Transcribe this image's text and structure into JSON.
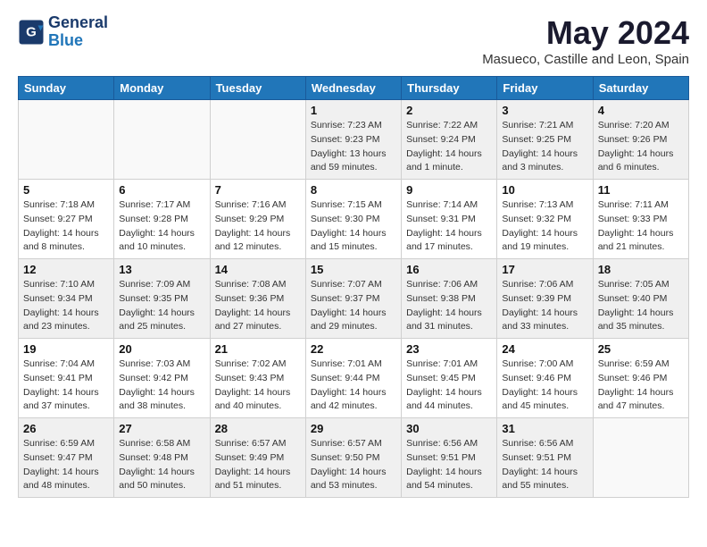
{
  "logo": {
    "line1": "General",
    "line2": "Blue"
  },
  "title": "May 2024",
  "location": "Masueco, Castille and Leon, Spain",
  "weekdays": [
    "Sunday",
    "Monday",
    "Tuesday",
    "Wednesday",
    "Thursday",
    "Friday",
    "Saturday"
  ],
  "weeks": [
    [
      {
        "day": "",
        "sunrise": "",
        "sunset": "",
        "daylight": ""
      },
      {
        "day": "",
        "sunrise": "",
        "sunset": "",
        "daylight": ""
      },
      {
        "day": "",
        "sunrise": "",
        "sunset": "",
        "daylight": ""
      },
      {
        "day": "1",
        "sunrise": "Sunrise: 7:23 AM",
        "sunset": "Sunset: 9:23 PM",
        "daylight": "Daylight: 13 hours and 59 minutes."
      },
      {
        "day": "2",
        "sunrise": "Sunrise: 7:22 AM",
        "sunset": "Sunset: 9:24 PM",
        "daylight": "Daylight: 14 hours and 1 minute."
      },
      {
        "day": "3",
        "sunrise": "Sunrise: 7:21 AM",
        "sunset": "Sunset: 9:25 PM",
        "daylight": "Daylight: 14 hours and 3 minutes."
      },
      {
        "day": "4",
        "sunrise": "Sunrise: 7:20 AM",
        "sunset": "Sunset: 9:26 PM",
        "daylight": "Daylight: 14 hours and 6 minutes."
      }
    ],
    [
      {
        "day": "5",
        "sunrise": "Sunrise: 7:18 AM",
        "sunset": "Sunset: 9:27 PM",
        "daylight": "Daylight: 14 hours and 8 minutes."
      },
      {
        "day": "6",
        "sunrise": "Sunrise: 7:17 AM",
        "sunset": "Sunset: 9:28 PM",
        "daylight": "Daylight: 14 hours and 10 minutes."
      },
      {
        "day": "7",
        "sunrise": "Sunrise: 7:16 AM",
        "sunset": "Sunset: 9:29 PM",
        "daylight": "Daylight: 14 hours and 12 minutes."
      },
      {
        "day": "8",
        "sunrise": "Sunrise: 7:15 AM",
        "sunset": "Sunset: 9:30 PM",
        "daylight": "Daylight: 14 hours and 15 minutes."
      },
      {
        "day": "9",
        "sunrise": "Sunrise: 7:14 AM",
        "sunset": "Sunset: 9:31 PM",
        "daylight": "Daylight: 14 hours and 17 minutes."
      },
      {
        "day": "10",
        "sunrise": "Sunrise: 7:13 AM",
        "sunset": "Sunset: 9:32 PM",
        "daylight": "Daylight: 14 hours and 19 minutes."
      },
      {
        "day": "11",
        "sunrise": "Sunrise: 7:11 AM",
        "sunset": "Sunset: 9:33 PM",
        "daylight": "Daylight: 14 hours and 21 minutes."
      }
    ],
    [
      {
        "day": "12",
        "sunrise": "Sunrise: 7:10 AM",
        "sunset": "Sunset: 9:34 PM",
        "daylight": "Daylight: 14 hours and 23 minutes."
      },
      {
        "day": "13",
        "sunrise": "Sunrise: 7:09 AM",
        "sunset": "Sunset: 9:35 PM",
        "daylight": "Daylight: 14 hours and 25 minutes."
      },
      {
        "day": "14",
        "sunrise": "Sunrise: 7:08 AM",
        "sunset": "Sunset: 9:36 PM",
        "daylight": "Daylight: 14 hours and 27 minutes."
      },
      {
        "day": "15",
        "sunrise": "Sunrise: 7:07 AM",
        "sunset": "Sunset: 9:37 PM",
        "daylight": "Daylight: 14 hours and 29 minutes."
      },
      {
        "day": "16",
        "sunrise": "Sunrise: 7:06 AM",
        "sunset": "Sunset: 9:38 PM",
        "daylight": "Daylight: 14 hours and 31 minutes."
      },
      {
        "day": "17",
        "sunrise": "Sunrise: 7:06 AM",
        "sunset": "Sunset: 9:39 PM",
        "daylight": "Daylight: 14 hours and 33 minutes."
      },
      {
        "day": "18",
        "sunrise": "Sunrise: 7:05 AM",
        "sunset": "Sunset: 9:40 PM",
        "daylight": "Daylight: 14 hours and 35 minutes."
      }
    ],
    [
      {
        "day": "19",
        "sunrise": "Sunrise: 7:04 AM",
        "sunset": "Sunset: 9:41 PM",
        "daylight": "Daylight: 14 hours and 37 minutes."
      },
      {
        "day": "20",
        "sunrise": "Sunrise: 7:03 AM",
        "sunset": "Sunset: 9:42 PM",
        "daylight": "Daylight: 14 hours and 38 minutes."
      },
      {
        "day": "21",
        "sunrise": "Sunrise: 7:02 AM",
        "sunset": "Sunset: 9:43 PM",
        "daylight": "Daylight: 14 hours and 40 minutes."
      },
      {
        "day": "22",
        "sunrise": "Sunrise: 7:01 AM",
        "sunset": "Sunset: 9:44 PM",
        "daylight": "Daylight: 14 hours and 42 minutes."
      },
      {
        "day": "23",
        "sunrise": "Sunrise: 7:01 AM",
        "sunset": "Sunset: 9:45 PM",
        "daylight": "Daylight: 14 hours and 44 minutes."
      },
      {
        "day": "24",
        "sunrise": "Sunrise: 7:00 AM",
        "sunset": "Sunset: 9:46 PM",
        "daylight": "Daylight: 14 hours and 45 minutes."
      },
      {
        "day": "25",
        "sunrise": "Sunrise: 6:59 AM",
        "sunset": "Sunset: 9:46 PM",
        "daylight": "Daylight: 14 hours and 47 minutes."
      }
    ],
    [
      {
        "day": "26",
        "sunrise": "Sunrise: 6:59 AM",
        "sunset": "Sunset: 9:47 PM",
        "daylight": "Daylight: 14 hours and 48 minutes."
      },
      {
        "day": "27",
        "sunrise": "Sunrise: 6:58 AM",
        "sunset": "Sunset: 9:48 PM",
        "daylight": "Daylight: 14 hours and 50 minutes."
      },
      {
        "day": "28",
        "sunrise": "Sunrise: 6:57 AM",
        "sunset": "Sunset: 9:49 PM",
        "daylight": "Daylight: 14 hours and 51 minutes."
      },
      {
        "day": "29",
        "sunrise": "Sunrise: 6:57 AM",
        "sunset": "Sunset: 9:50 PM",
        "daylight": "Daylight: 14 hours and 53 minutes."
      },
      {
        "day": "30",
        "sunrise": "Sunrise: 6:56 AM",
        "sunset": "Sunset: 9:51 PM",
        "daylight": "Daylight: 14 hours and 54 minutes."
      },
      {
        "day": "31",
        "sunrise": "Sunrise: 6:56 AM",
        "sunset": "Sunset: 9:51 PM",
        "daylight": "Daylight: 14 hours and 55 minutes."
      },
      {
        "day": "",
        "sunrise": "",
        "sunset": "",
        "daylight": ""
      }
    ]
  ]
}
